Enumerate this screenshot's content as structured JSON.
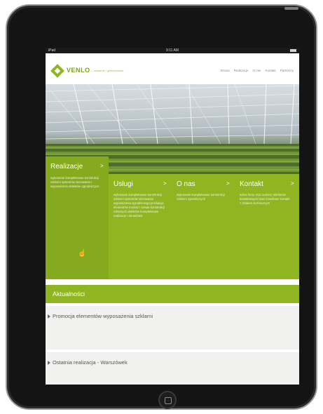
{
  "statusbar": {
    "carrier": "iPad",
    "clock": "9:11 AM"
  },
  "header": {
    "logo_text": "VENLO",
    "tagline": "— szklarnie / greenhouses",
    "nav": [
      "Strona",
      "Realizacje",
      "O nas",
      "Kontakt",
      "Partnerzy"
    ]
  },
  "tiles": [
    {
      "title": "Realizacje",
      "arrow": ">",
      "desc": "wykonanie kompleksowe konstrukcji szklarni systemów sterowania i wyposażenia obiektów ogrodniczych"
    },
    {
      "title": "Usługi",
      "arrow": ">",
      "desc": "wykonanie kompleksowe konstrukcji szklarni systemów sterowania wyposażenia ogrodniczego produkcja elementów montaż i serwis konstrukcji szklanych obiektów kompleksowe realizacje i doradztwo"
    },
    {
      "title": "O nas",
      "arrow": ">",
      "desc": "wykonanie kompleksowe konstrukcji szklarni ogrodniczych"
    },
    {
      "title": "Kontakt",
      "arrow": ">",
      "desc": "adres firmy oraz numery telefonów kontaktowych biuro handlowe kontakt z działem technicznym"
    }
  ],
  "aktualnosci": {
    "title": "Aktualności"
  },
  "news": [
    {
      "title": "Promocja elementów wyposażenia szklarni",
      "date": "",
      "body": ""
    },
    {
      "title": "Ostatnia realizacja - Warszówek",
      "date": "",
      "body": ""
    }
  ],
  "colors": {
    "accent": "#8fb520",
    "accent_dark": "#7da11b",
    "bezel": "#141414"
  }
}
